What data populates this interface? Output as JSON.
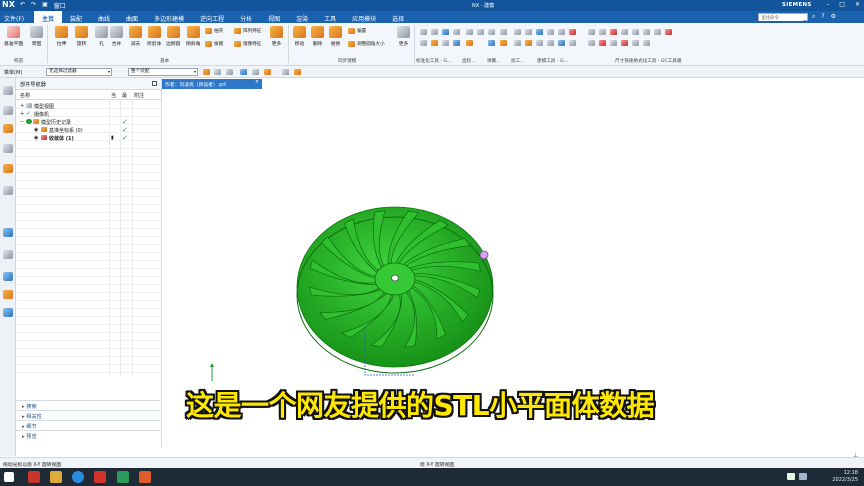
{
  "titlebar": {
    "logo": "NX",
    "window_title": "NX - 建模",
    "qat_window_menu": "窗口",
    "brand": "SIEMENS"
  },
  "menubar": {
    "file": "文件(F)",
    "tabs": [
      "主页",
      "装配",
      "曲线",
      "曲面",
      "多边形建模",
      "逆向工程",
      "分析",
      "视图",
      "渲染",
      "工具",
      "应用模块",
      "选择"
    ],
    "active_tab": "主页",
    "search_placeholder": "查找命令"
  },
  "ribbon": {
    "buttons": {
      "datum_plane": "基准平面",
      "sketch": "草图",
      "extrude": "拉伸",
      "revolve": "旋转",
      "hole": "孔",
      "unite": "合并",
      "subtract": "减去",
      "trim_body": "修剪体",
      "edge_blend": "边倒圆",
      "chamfer": "倒斜角",
      "shell": "抽壳",
      "draft": "拔模",
      "pattern_feature": "阵列特征",
      "mirror_feature": "镜像特征",
      "more1": "更多",
      "move": "移动",
      "delete": "删除",
      "replace": "替换",
      "offset": "偏置",
      "resize_blend": "调整圆角大小",
      "more2": "更多"
    },
    "groups": {
      "construct": "构造",
      "base": "基本",
      "sync": "同步建模",
      "standard": "标准化工具 - G...",
      "gear": "齿轮...",
      "spring": "弹簧...",
      "machining": "加工...",
      "build_tools": "建模工具 - G...",
      "dimension_tools": "尺寸快速格式化工具 - GC工具箱"
    }
  },
  "selbar": {
    "menu": "菜单(M)",
    "filter": "无选择过滤器",
    "scope": "整个装配"
  },
  "navigator": {
    "title": "部件导航器",
    "columns": [
      "名称",
      "当",
      "最",
      "附注"
    ],
    "rows": [
      {
        "label": "模型视图",
        "check": ""
      },
      {
        "label": "摄像机",
        "check": ""
      },
      {
        "label": "模型历史记录",
        "check": "✓"
      },
      {
        "label": "基准坐标系 (0)",
        "check": "✓"
      },
      {
        "label": "收敛体 (1)",
        "check": "✓"
      }
    ],
    "panels": [
      "搜索",
      "相关性",
      "细节",
      "预览"
    ]
  },
  "doc_tab": "作者：刘凌亮（四设者）.prt",
  "subtitle": "这是一个网友提供的STL小平面体数据",
  "status": {
    "left": "拖动光标以绕 X-Y 旋转视图",
    "center": "绕 X-Y 旋转视图"
  },
  "taskbar": {
    "time": "12:18",
    "date": "2022/3/25"
  },
  "colors": {
    "title_blue": "#12559c",
    "menu_blue": "#1a62ae",
    "model_green": "#2ab52a",
    "subtitle_yellow": "#ffe800"
  }
}
